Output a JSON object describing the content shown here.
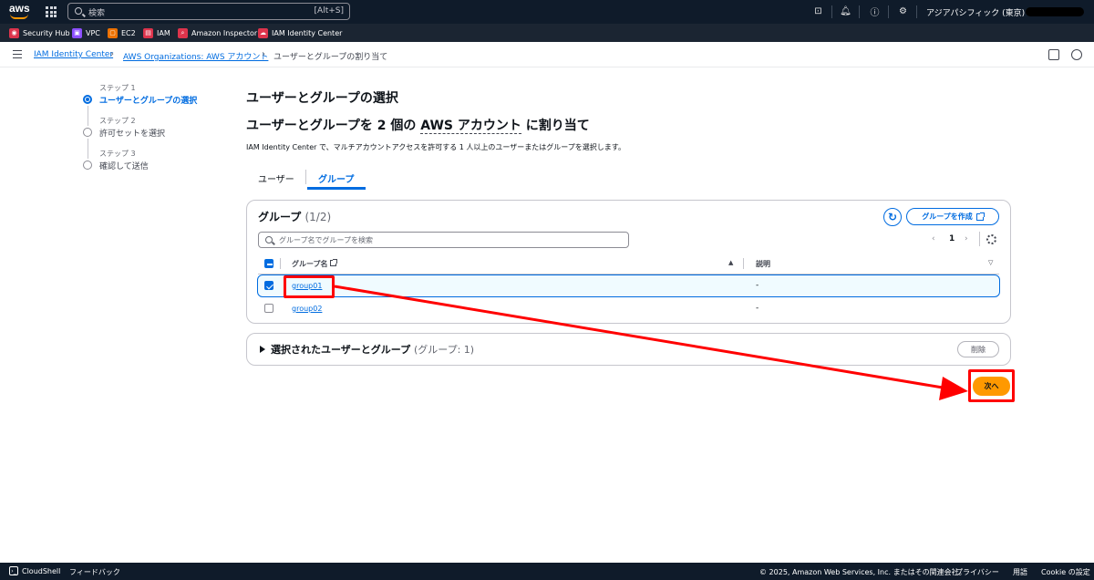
{
  "topnav": {
    "search_placeholder": "検索",
    "search_shortcut": "[Alt+S]",
    "region": "アジアパシフィック (東京) ▾"
  },
  "favorites": [
    {
      "label": "Security Hub",
      "color": "#dd344c",
      "icon": "security-hub-icon"
    },
    {
      "label": "VPC",
      "color": "#8c4fff",
      "icon": "vpc-icon"
    },
    {
      "label": "EC2",
      "color": "#ed7100",
      "icon": "ec2-icon"
    },
    {
      "label": "IAM",
      "color": "#dd344c",
      "icon": "iam-icon"
    },
    {
      "label": "Amazon Inspector",
      "color": "#dd344c",
      "icon": "inspector-icon"
    },
    {
      "label": "IAM Identity Center",
      "color": "#dd344c",
      "icon": "identity-center-icon"
    }
  ],
  "breadcrumb": {
    "items": [
      "IAM Identity Center",
      "AWS Organizations: AWS アカウント",
      "ユーザーとグループの割り当て"
    ]
  },
  "steps": [
    {
      "label": "ステップ 1",
      "name": "ユーザーとグループの選択",
      "active": true
    },
    {
      "label": "ステップ 2",
      "name": "許可セットを選択",
      "active": false
    },
    {
      "label": "ステップ 3",
      "name": "確認して送信",
      "active": false
    }
  ],
  "page": {
    "title": "ユーザーとグループの選択",
    "subtitle_prefix": "ユーザーとグループを 2 個の ",
    "subtitle_link": "AWS アカウント",
    "subtitle_suffix": " に割り当て",
    "description": "IAM Identity Center で、マルチアカウントアクセスを許可する 1 人以上のユーザーまたはグループを選択します。"
  },
  "tabs": [
    {
      "label": "ユーザー",
      "active": false
    },
    {
      "label": "グループ",
      "active": true
    }
  ],
  "groups_panel": {
    "title": "グループ",
    "count": "(1/2)",
    "create_label": "グループを作成",
    "filter_placeholder": "グループ名でグループを検索",
    "page": "1",
    "columns": [
      "グループ名",
      "説明"
    ],
    "rows": [
      {
        "name": "group01",
        "description": "-",
        "selected": true
      },
      {
        "name": "group02",
        "description": "-",
        "selected": false
      }
    ]
  },
  "selected_panel": {
    "title": "選択されたユーザーとグループ",
    "count": "(グループ: 1)",
    "delete_label": "削除"
  },
  "next_label": "次へ",
  "footer": {
    "cloudshell": "CloudShell",
    "feedback": "フィードバック",
    "copyright": "© 2025, Amazon Web Services, Inc. またはその関連会社。",
    "privacy": "プライバシー",
    "terms": "用語",
    "cookie": "Cookie の設定"
  },
  "colors": {
    "accent": "#006ce0",
    "primary_button": "#ff9900",
    "annotation": "#ff0000"
  }
}
